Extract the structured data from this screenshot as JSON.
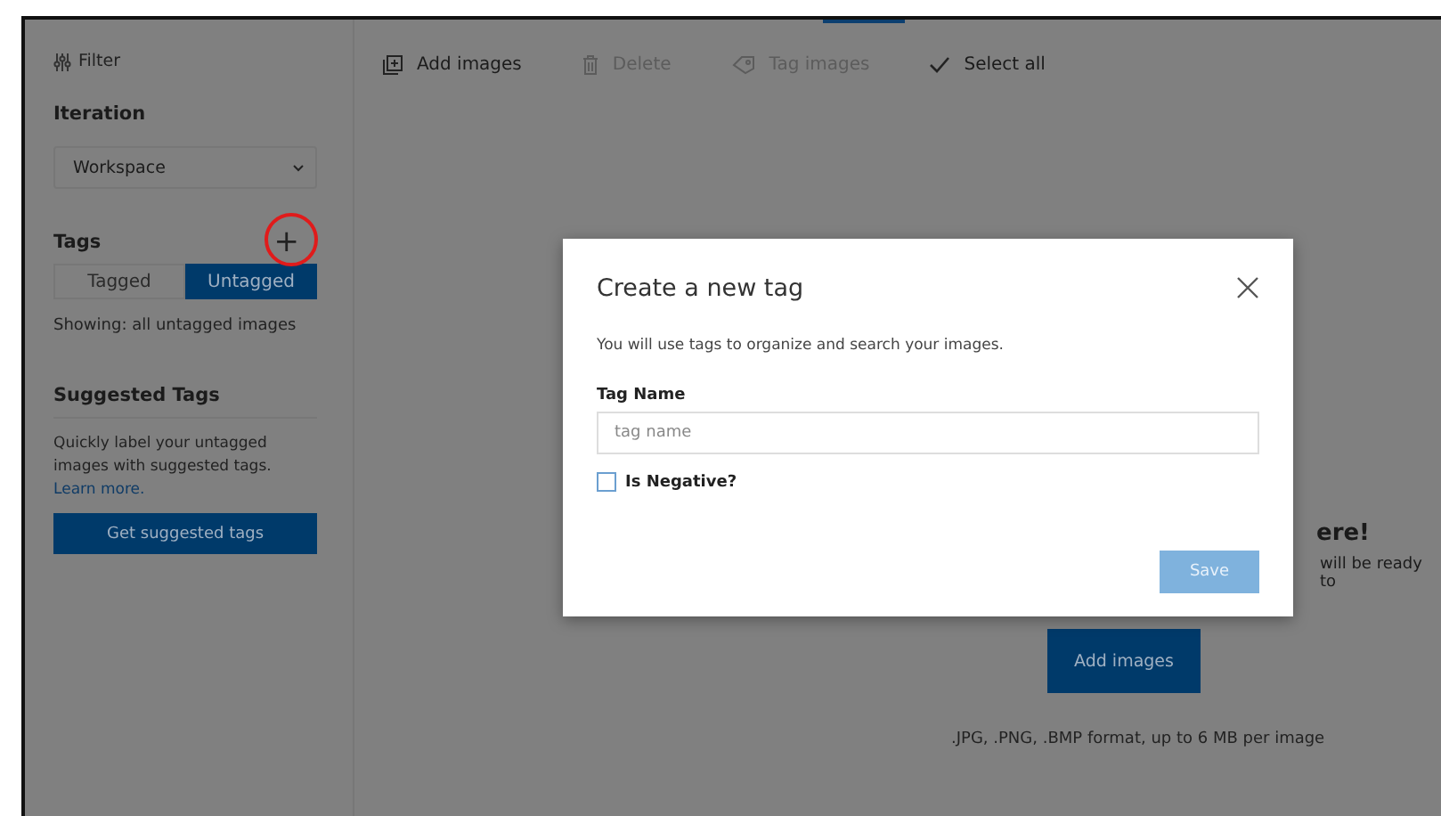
{
  "sidebar": {
    "filter": "Filter",
    "iteration": {
      "label": "Iteration",
      "value": "Workspace"
    },
    "tags": {
      "title": "Tags",
      "add": "+",
      "toggle": [
        {
          "label": "Tagged",
          "selected": false
        },
        {
          "label": "Untagged",
          "selected": true
        }
      ],
      "showing": "Showing: all untagged images"
    },
    "suggested": {
      "title": "Suggested Tags",
      "text": "Quickly label your untagged images with suggested tags.",
      "link": "Learn more.",
      "button": "Get suggested tags"
    }
  },
  "toolbar": [
    {
      "kind": "add",
      "label": "Add images",
      "disabled": false
    },
    {
      "kind": "delete",
      "label": "Delete",
      "disabled": true
    },
    {
      "kind": "tag",
      "label": "Tag images",
      "disabled": true
    },
    {
      "kind": "check",
      "label": "Select all",
      "disabled": false
    }
  ],
  "empty_state": {
    "heading": "ere!",
    "text": "will be ready to",
    "button": "Add images",
    "formats": ".JPG, .PNG, .BMP format, up to 6 MB per image"
  },
  "dialog": {
    "title": "Create a new tag",
    "description": "You will use tags to organize and search your images.",
    "field_label": "Tag Name",
    "placeholder": "tag name",
    "negative": {
      "label": "Is Negative?",
      "checked": false
    },
    "save": "Save"
  }
}
